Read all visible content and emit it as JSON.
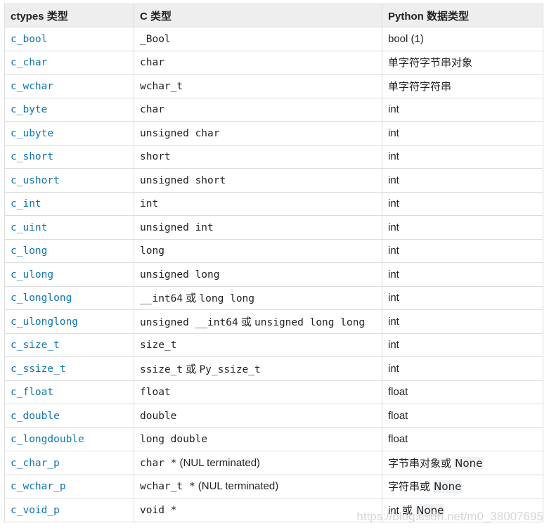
{
  "header": {
    "col1": "ctypes 类型",
    "col2": "C 类型",
    "col3": "Python 数据类型"
  },
  "rows": [
    {
      "ctype": "c_bool",
      "c": [
        {
          "t": "_Bool",
          "mono": true
        }
      ],
      "py": [
        {
          "t": "bool (1)"
        }
      ]
    },
    {
      "ctype": "c_char",
      "c": [
        {
          "t": "char",
          "mono": true
        }
      ],
      "py": [
        {
          "t": "单字符字节串对象"
        }
      ]
    },
    {
      "ctype": "c_wchar",
      "c": [
        {
          "t": "wchar_t",
          "mono": true
        }
      ],
      "py": [
        {
          "t": "单字符字符串"
        }
      ]
    },
    {
      "ctype": "c_byte",
      "c": [
        {
          "t": "char",
          "mono": true
        }
      ],
      "py": [
        {
          "t": "int"
        }
      ]
    },
    {
      "ctype": "c_ubyte",
      "c": [
        {
          "t": "unsigned char",
          "mono": true
        }
      ],
      "py": [
        {
          "t": "int"
        }
      ]
    },
    {
      "ctype": "c_short",
      "c": [
        {
          "t": "short",
          "mono": true
        }
      ],
      "py": [
        {
          "t": "int"
        }
      ]
    },
    {
      "ctype": "c_ushort",
      "c": [
        {
          "t": "unsigned short",
          "mono": true
        }
      ],
      "py": [
        {
          "t": "int"
        }
      ]
    },
    {
      "ctype": "c_int",
      "c": [
        {
          "t": "int",
          "mono": true
        }
      ],
      "py": [
        {
          "t": "int"
        }
      ]
    },
    {
      "ctype": "c_uint",
      "c": [
        {
          "t": "unsigned int",
          "mono": true
        }
      ],
      "py": [
        {
          "t": "int"
        }
      ]
    },
    {
      "ctype": "c_long",
      "c": [
        {
          "t": "long",
          "mono": true
        }
      ],
      "py": [
        {
          "t": "int"
        }
      ]
    },
    {
      "ctype": "c_ulong",
      "c": [
        {
          "t": "unsigned long",
          "mono": true
        }
      ],
      "py": [
        {
          "t": "int"
        }
      ]
    },
    {
      "ctype": "c_longlong",
      "c": [
        {
          "t": "__int64",
          "mono": true
        },
        {
          "t": " 或 "
        },
        {
          "t": "long long",
          "mono": true
        }
      ],
      "py": [
        {
          "t": "int"
        }
      ]
    },
    {
      "ctype": "c_ulonglong",
      "c": [
        {
          "t": "unsigned __int64",
          "mono": true
        },
        {
          "t": " 或 "
        },
        {
          "t": "unsigned long long",
          "mono": true
        }
      ],
      "py": [
        {
          "t": "int"
        }
      ]
    },
    {
      "ctype": "c_size_t",
      "c": [
        {
          "t": "size_t",
          "mono": true
        }
      ],
      "py": [
        {
          "t": "int"
        }
      ]
    },
    {
      "ctype": "c_ssize_t",
      "c": [
        {
          "t": "ssize_t",
          "mono": true
        },
        {
          "t": " 或 "
        },
        {
          "t": "Py_ssize_t",
          "mono": true
        }
      ],
      "py": [
        {
          "t": "int"
        }
      ]
    },
    {
      "ctype": "c_float",
      "c": [
        {
          "t": "float",
          "mono": true
        }
      ],
      "py": [
        {
          "t": "float"
        }
      ]
    },
    {
      "ctype": "c_double",
      "c": [
        {
          "t": "double",
          "mono": true
        }
      ],
      "py": [
        {
          "t": "float"
        }
      ]
    },
    {
      "ctype": "c_longdouble",
      "c": [
        {
          "t": "long double",
          "mono": true
        }
      ],
      "py": [
        {
          "t": "float"
        }
      ]
    },
    {
      "ctype": "c_char_p",
      "c": [
        {
          "t": "char *",
          "mono": true
        },
        {
          "t": " (NUL terminated)"
        }
      ],
      "py": [
        {
          "t": "字节串对象或 "
        },
        {
          "t": "None",
          "code": true
        }
      ]
    },
    {
      "ctype": "c_wchar_p",
      "c": [
        {
          "t": "wchar_t *",
          "mono": true
        },
        {
          "t": " (NUL terminated)"
        }
      ],
      "py": [
        {
          "t": "字符串或 "
        },
        {
          "t": "None",
          "code": true
        }
      ]
    },
    {
      "ctype": "c_void_p",
      "c": [
        {
          "t": "void *",
          "mono": true
        }
      ],
      "py": [
        {
          "t": "int 或 "
        },
        {
          "t": "None",
          "code": true
        }
      ]
    }
  ],
  "watermark": "https://blog.csdn.net/m0_38007695",
  "colors": {
    "link": "#0e76b0",
    "header_bg": "#eeeeee",
    "border": "#dddddd"
  }
}
